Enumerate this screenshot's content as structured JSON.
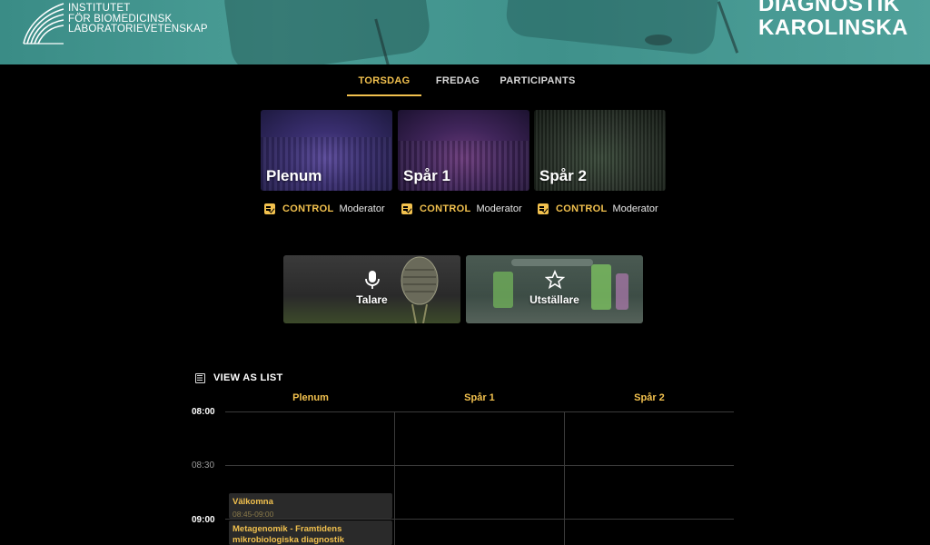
{
  "header": {
    "logo_lines": [
      "INSTITUTET",
      "FÖR BIOMEDICINSK",
      "LABORATORIEVETENSKAP"
    ],
    "brand_lines": [
      "DIAGNOSTIK",
      "KAROLINSKA"
    ]
  },
  "tabs": [
    {
      "label": "TORSDAG",
      "active": true
    },
    {
      "label": "FREDAG",
      "active": false
    },
    {
      "label": "PARTICIPANTS",
      "active": false
    }
  ],
  "rooms": [
    {
      "name": "Plenum",
      "control": "CONTROL",
      "role": "Moderator"
    },
    {
      "name": "Spår 1",
      "control": "CONTROL",
      "role": "Moderator"
    },
    {
      "name": "Spår 2",
      "control": "CONTROL",
      "role": "Moderator"
    }
  ],
  "features": [
    {
      "label": "Talare",
      "icon": "microphone-icon"
    },
    {
      "label": "Utställare",
      "icon": "star-icon"
    }
  ],
  "schedule": {
    "view_as_list": "VIEW AS LIST",
    "columns": [
      "Plenum",
      "Spår 1",
      "Spår 2"
    ],
    "times": [
      "08:00",
      "08:30",
      "09:00"
    ],
    "events": [
      {
        "title": "Välkomna",
        "time": "08:45-09:00",
        "column": "Plenum"
      },
      {
        "title": "Metagenomik - Framtidens mikrobiologiska diagnostik",
        "time": "",
        "column": "Plenum"
      }
    ]
  },
  "colors": {
    "accent": "#f2c14e",
    "banner": "#4a9d96",
    "background": "#000000"
  }
}
